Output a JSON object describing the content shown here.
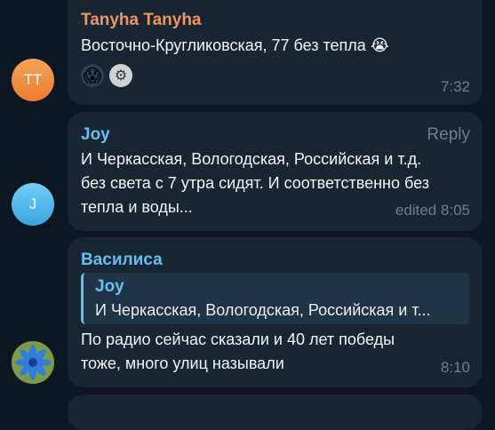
{
  "messages": [
    {
      "sender": "Tanyha Tanyha",
      "sender_color": "#f0965a",
      "avatar_initials": "TT",
      "text_line_1": "Восточно-Кругликовская, 77 без тепла",
      "emoji_after_text": "😭",
      "reactions": [
        "😱",
        "⚙"
      ],
      "time": "7:32"
    },
    {
      "sender": "Joy",
      "sender_color": "#62c0f0",
      "avatar_initials": "J",
      "reply_label": "Reply",
      "lines": [
        "И Черкасская, Вологодская, Российская и т.д.",
        "без света с 7 утра сидят. И соответственно без",
        "тепла и воды..."
      ],
      "time": "edited 8:05"
    },
    {
      "sender": "Василиса",
      "sender_color": "#62c0f0",
      "quote": {
        "name": "Joy",
        "text": "И Черкасская, Вологодская, Российская и т..."
      },
      "lines": [
        "По радио сейчас сказали и 40 лет победы",
        "тоже, много улиц называли"
      ],
      "time": "8:10"
    }
  ]
}
